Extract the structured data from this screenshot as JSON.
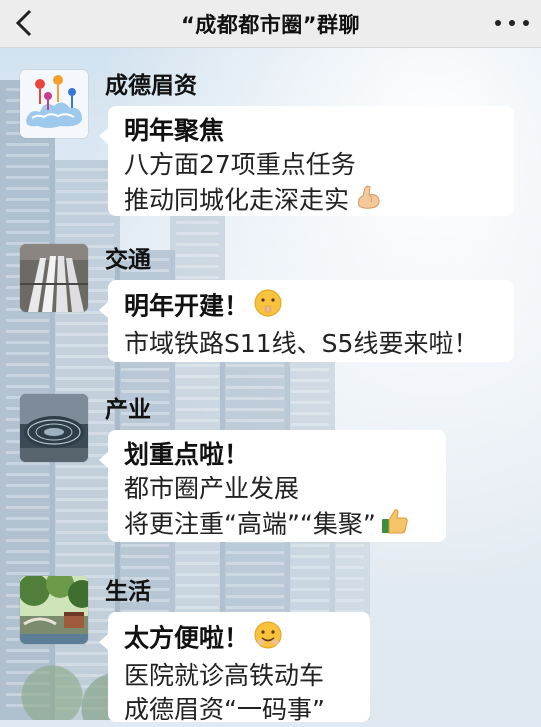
{
  "header": {
    "title": "“成都都市圈”群聊",
    "back_icon": "chevron-left-icon",
    "more_icon": "more-dots-icon"
  },
  "messages": [
    {
      "sender": "成德眉资",
      "avatar": "map-pins-avatar",
      "lines": [
        "明年聚焦",
        "八方面27项重点任务",
        "推动同城化走深走实"
      ],
      "emoji": "flexed-biceps-icon"
    },
    {
      "sender": "交通",
      "avatar": "trains-avatar",
      "lines": [
        "明年开建！",
        "市域铁路S11线、S5线要来啦！"
      ],
      "emoji": "hushing-face-icon"
    },
    {
      "sender": "产业",
      "avatar": "industry-dome-avatar",
      "lines": [
        "划重点啦！",
        "都市圈产业发展",
        "将更注重“高端”“集聚”"
      ],
      "emoji": "thumbs-up-icon"
    },
    {
      "sender": "生活",
      "avatar": "park-avatar",
      "lines": [
        "太方便啦！",
        "医院就诊高铁动车",
        "成德眉资“一码事”"
      ],
      "emoji": "smiling-face-icon"
    }
  ]
}
